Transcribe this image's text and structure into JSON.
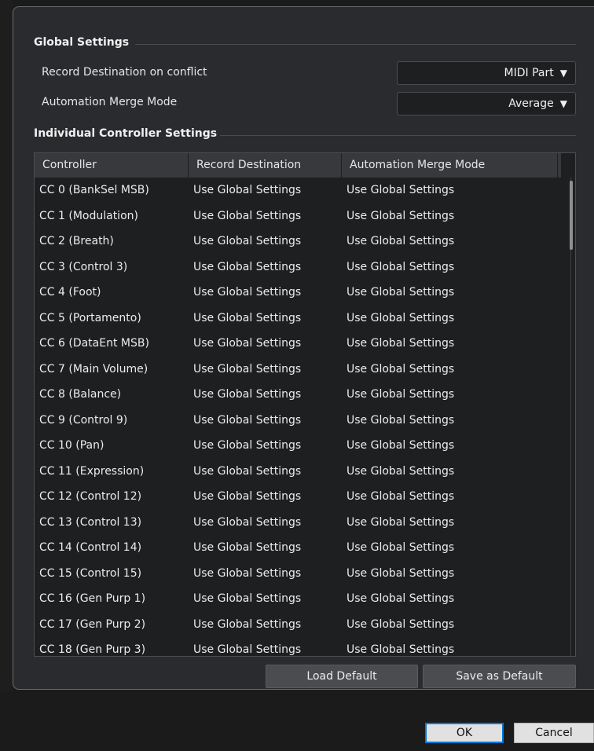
{
  "global": {
    "title": "Global Settings",
    "record_destination_label": "Record Destination on conflict",
    "record_destination_value": "MIDI Part",
    "merge_mode_label": "Automation Merge Mode",
    "merge_mode_value": "Average"
  },
  "individual": {
    "title": "Individual Controller Settings",
    "columns": [
      "Controller",
      "Record Destination",
      "Automation Merge Mode"
    ],
    "rows": [
      [
        "CC 0  (BankSel MSB)",
        "Use Global Settings",
        "Use Global Settings"
      ],
      [
        "CC 1  (Modulation)",
        "Use Global Settings",
        "Use Global Settings"
      ],
      [
        "CC 2  (Breath)",
        "Use Global Settings",
        "Use Global Settings"
      ],
      [
        "CC 3  (Control 3)",
        "Use Global Settings",
        "Use Global Settings"
      ],
      [
        "CC 4  (Foot)",
        "Use Global Settings",
        "Use Global Settings"
      ],
      [
        "CC 5  (Portamento)",
        "Use Global Settings",
        "Use Global Settings"
      ],
      [
        "CC 6  (DataEnt MSB)",
        "Use Global Settings",
        "Use Global Settings"
      ],
      [
        "CC 7  (Main Volume)",
        "Use Global Settings",
        "Use Global Settings"
      ],
      [
        "CC 8  (Balance)",
        "Use Global Settings",
        "Use Global Settings"
      ],
      [
        "CC 9  (Control 9)",
        "Use Global Settings",
        "Use Global Settings"
      ],
      [
        "CC 10  (Pan)",
        "Use Global Settings",
        "Use Global Settings"
      ],
      [
        "CC 11  (Expression)",
        "Use Global Settings",
        "Use Global Settings"
      ],
      [
        "CC 12  (Control 12)",
        "Use Global Settings",
        "Use Global Settings"
      ],
      [
        "CC 13  (Control 13)",
        "Use Global Settings",
        "Use Global Settings"
      ],
      [
        "CC 14  (Control 14)",
        "Use Global Settings",
        "Use Global Settings"
      ],
      [
        "CC 15  (Control 15)",
        "Use Global Settings",
        "Use Global Settings"
      ],
      [
        "CC 16  (Gen Purp 1)",
        "Use Global Settings",
        "Use Global Settings"
      ],
      [
        "CC 17  (Gen Purp 2)",
        "Use Global Settings",
        "Use Global Settings"
      ],
      [
        "CC 18  (Gen Purp 3)",
        "Use Global Settings",
        "Use Global Settings"
      ]
    ]
  },
  "buttons": {
    "load_default": "Load Default",
    "save_default": "Save as Default",
    "ok": "OK",
    "cancel": "Cancel"
  },
  "icons": {
    "dropdown_arrow": "▼"
  }
}
